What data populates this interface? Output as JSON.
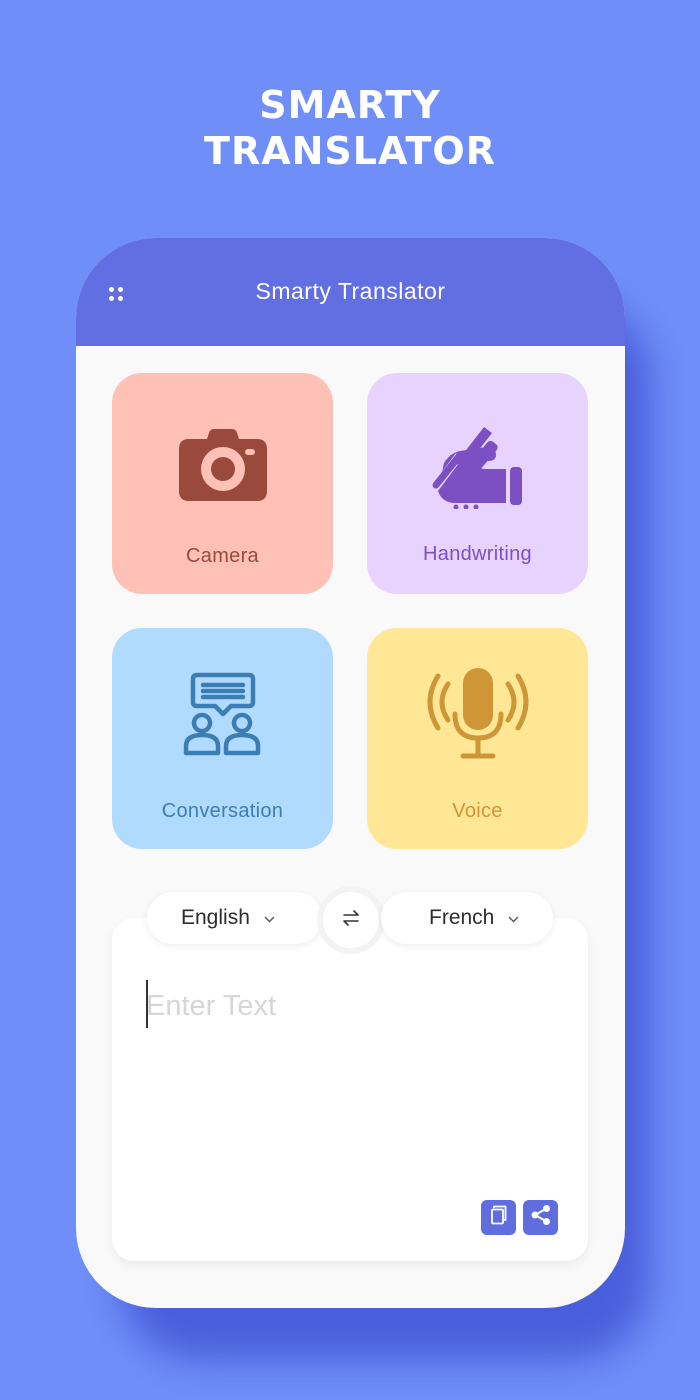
{
  "promo": {
    "title_line1": "SMARTY",
    "title_line2": "TRANSLATOR"
  },
  "header": {
    "menu_icon": "grid-dots-icon",
    "title": "Smarty Translator"
  },
  "tiles": [
    {
      "label": "Camera",
      "icon": "camera-icon",
      "bg": "#ffc1b6",
      "fg": "#9a4a3c"
    },
    {
      "label": "Handwriting",
      "icon": "handwriting-icon",
      "bg": "#e8d3fe",
      "fg": "#7c4fc2"
    },
    {
      "label": "Conversation",
      "icon": "conversation-icon",
      "bg": "#b1daff",
      "fg": "#3c7eb4"
    },
    {
      "label": "Voice",
      "icon": "microphone-icon",
      "bg": "#ffe795",
      "fg": "#cf9638"
    }
  ],
  "translator": {
    "source_language": "English",
    "target_language": "French",
    "swap_icon": "swap-arrows-icon",
    "input_value": "",
    "input_placeholder": "Enter Text",
    "copy_icon": "copy-icon",
    "share_icon": "share-icon"
  },
  "colors": {
    "background": "#6f8ef8",
    "header": "#616fe2",
    "accent": "#5f6ddf"
  }
}
